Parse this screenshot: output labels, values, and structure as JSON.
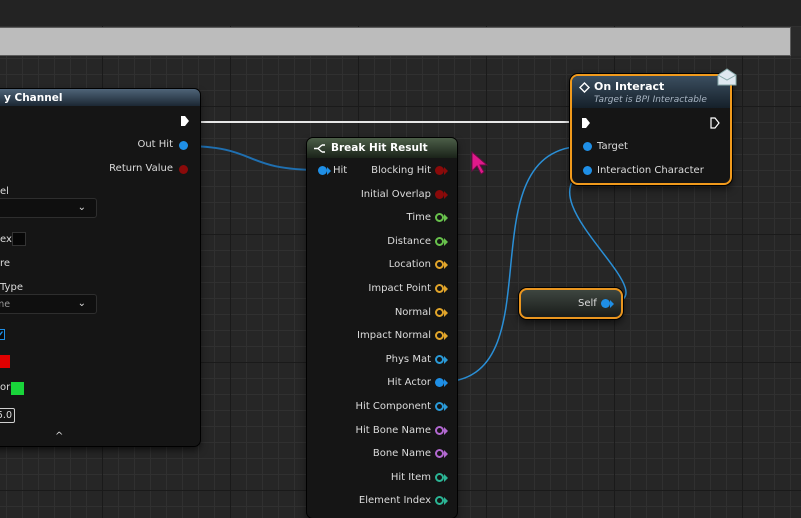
{
  "trace_node": {
    "title": "y Channel",
    "pins": {
      "out_hit": "Out Hit",
      "return_value": "Return Value",
      "channel_label": "el",
      "index_label": "ex",
      "ignore_label": "re",
      "draw_type_label": "Type",
      "draw_type_value": "me",
      "trace_color_label": "",
      "hit_color_label": "or",
      "draw_time_value": "5.0"
    }
  },
  "break_node": {
    "title": "Break Hit Result",
    "input": "Hit",
    "outputs": [
      "Blocking Hit",
      "Initial Overlap",
      "Time",
      "Distance",
      "Location",
      "Impact Point",
      "Normal",
      "Impact Normal",
      "Phys Mat",
      "Hit Actor",
      "Hit Component",
      "Hit Bone Name",
      "Bone Name",
      "Hit Item",
      "Element Index"
    ]
  },
  "interact_node": {
    "title": "On Interact",
    "subtitle": "Target is BPI Interactable",
    "target_label": "Target",
    "character_label": "Interaction Character"
  },
  "self_node": {
    "label": "Self"
  },
  "colors": {
    "exec": "#ffffff",
    "object_pin": "#1f8fe6",
    "bool_pin": "#8a0a0a",
    "float_pin": "#68c24c",
    "vector_pin": "#e2a52a",
    "name_pin": "#b268d0",
    "int_pin": "#2bb595",
    "selection": "#f19a1c",
    "trace_color": "#e00000",
    "hit_color": "#19d43a"
  }
}
